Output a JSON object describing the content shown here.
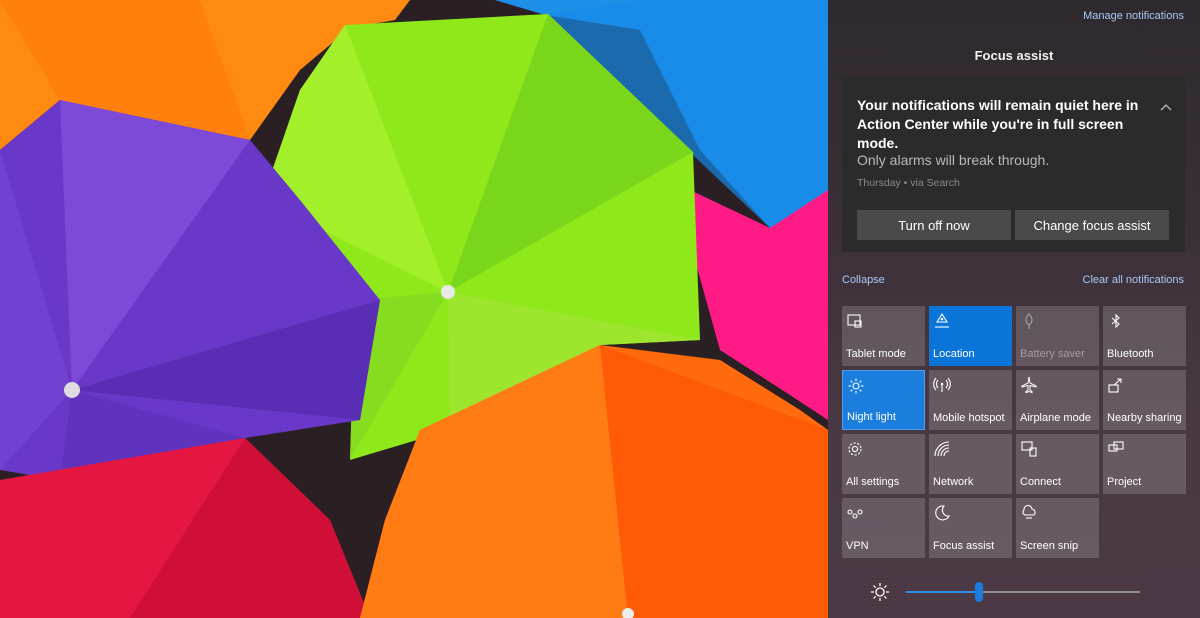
{
  "action_center": {
    "manage_notifications": "Manage notifications",
    "group_title": "Focus assist",
    "toast": {
      "title": "Your notifications will remain quiet here in Action Center while you're in full screen mode.",
      "body": "Only alarms will break through.",
      "meta": "Thursday • via Search",
      "button_primary": "Turn off now",
      "button_secondary": "Change focus assist"
    },
    "collapse": "Collapse",
    "clear_all": "Clear all notifications",
    "quick_actions": [
      {
        "label": "Tablet mode",
        "icon": "tablet-mode-icon",
        "state": "off"
      },
      {
        "label": "Location",
        "icon": "location-icon",
        "state": "on"
      },
      {
        "label": "Battery saver",
        "icon": "battery-saver-icon",
        "state": "disabled"
      },
      {
        "label": "Bluetooth",
        "icon": "bluetooth-icon",
        "state": "off"
      },
      {
        "label": "Night light",
        "icon": "night-light-icon",
        "state": "on"
      },
      {
        "label": "Mobile hotspot",
        "icon": "mobile-hotspot-icon",
        "state": "off"
      },
      {
        "label": "Airplane mode",
        "icon": "airplane-icon",
        "state": "off"
      },
      {
        "label": "Nearby sharing",
        "icon": "nearby-sharing-icon",
        "state": "off"
      },
      {
        "label": "All settings",
        "icon": "gear-icon",
        "state": "off"
      },
      {
        "label": "Network",
        "icon": "network-icon",
        "state": "off"
      },
      {
        "label": "Connect",
        "icon": "connect-icon",
        "state": "off"
      },
      {
        "label": "Project",
        "icon": "project-icon",
        "state": "off"
      },
      {
        "label": "VPN",
        "icon": "vpn-icon",
        "state": "off"
      },
      {
        "label": "Focus assist",
        "icon": "moon-icon",
        "state": "off"
      },
      {
        "label": "Screen snip",
        "icon": "screen-snip-icon",
        "state": "off"
      }
    ],
    "brightness": {
      "icon": "brightness-icon",
      "level": 0.31
    },
    "colors": {
      "accent": "#0a74d9",
      "link": "#a9c9f5",
      "toast_bg": "#2b2b2b"
    }
  }
}
